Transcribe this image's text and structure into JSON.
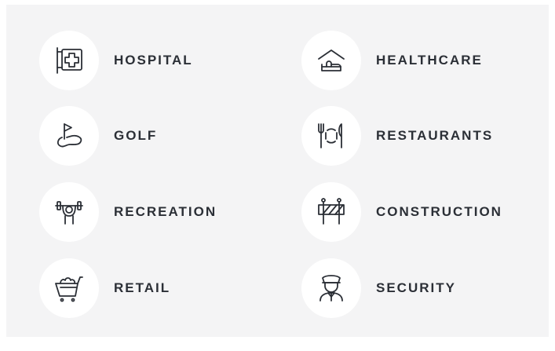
{
  "categories": [
    {
      "label": "HOSPITAL",
      "icon": "hospital-sign-icon"
    },
    {
      "label": "HEALTHCARE",
      "icon": "home-bed-icon"
    },
    {
      "label": "GOLF",
      "icon": "golf-flag-icon"
    },
    {
      "label": "RESTAURANTS",
      "icon": "fork-plate-knife-icon"
    },
    {
      "label": "RECREATION",
      "icon": "weightlifter-icon"
    },
    {
      "label": "CONSTRUCTION",
      "icon": "road-barrier-icon"
    },
    {
      "label": "RETAIL",
      "icon": "shopping-cart-icon"
    },
    {
      "label": "SECURITY",
      "icon": "security-guard-icon"
    }
  ],
  "colors": {
    "background": "#f4f4f5",
    "circle": "#ffffff",
    "text": "#2b2f36"
  }
}
